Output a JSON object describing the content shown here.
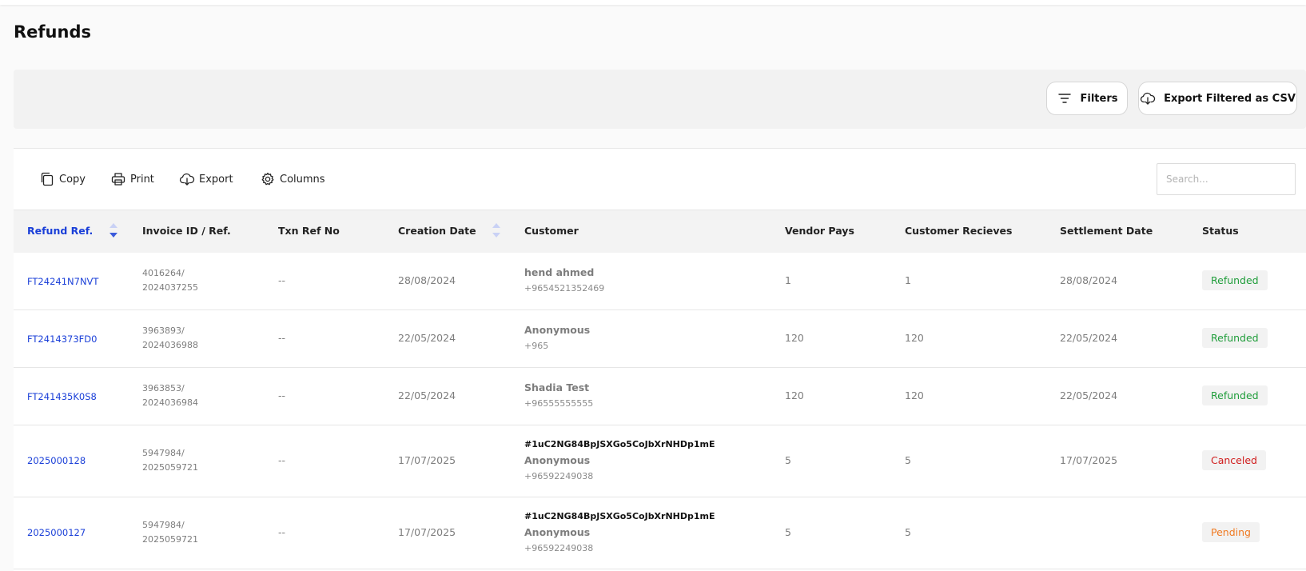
{
  "page": {
    "title": "Refunds"
  },
  "filter_bar": {
    "filters_label": "Filters",
    "export_csv_label": "Export Filtered as CSV"
  },
  "toolbar": {
    "copy_label": "Copy",
    "print_label": "Print",
    "export_label": "Export",
    "columns_label": "Columns",
    "search_placeholder": "Search..."
  },
  "table": {
    "columns": [
      "Refund Ref.",
      "Invoice ID / Ref.",
      "Txn Ref No",
      "Creation Date",
      "Customer",
      "Vendor Pays",
      "Customer Recieves",
      "Settlement Date",
      "Status"
    ],
    "rows": [
      {
        "refund_ref": "FT24241N7NVT",
        "invoice_id": "4016264/",
        "invoice_ref": "2024037255",
        "txn_ref": "--",
        "creation_date": "28/08/2024",
        "customer_token": "",
        "customer_name": "hend ahmed",
        "customer_phone": "+9654521352469",
        "vendor_pays": "1",
        "customer_receives": "1",
        "settlement_date": "28/08/2024",
        "status": "Refunded"
      },
      {
        "refund_ref": "FT2414373FD0",
        "invoice_id": "3963893/",
        "invoice_ref": "2024036988",
        "txn_ref": "--",
        "creation_date": "22/05/2024",
        "customer_token": "",
        "customer_name": "Anonymous",
        "customer_phone": "+965",
        "vendor_pays": "120",
        "customer_receives": "120",
        "settlement_date": "22/05/2024",
        "status": "Refunded"
      },
      {
        "refund_ref": "FT241435K0S8",
        "invoice_id": "3963853/",
        "invoice_ref": "2024036984",
        "txn_ref": "--",
        "creation_date": "22/05/2024",
        "customer_token": "",
        "customer_name": "Shadia Test",
        "customer_phone": "+96555555555",
        "vendor_pays": "120",
        "customer_receives": "120",
        "settlement_date": "22/05/2024",
        "status": "Refunded"
      },
      {
        "refund_ref": "2025000128",
        "invoice_id": "5947984/",
        "invoice_ref": "2025059721",
        "txn_ref": "--",
        "creation_date": "17/07/2025",
        "customer_token": "#1uC2NG84BpJSXGo5CoJbXrNHDp1mE",
        "customer_name": "Anonymous",
        "customer_phone": "+96592249038",
        "vendor_pays": "5",
        "customer_receives": "5",
        "settlement_date": "17/07/2025",
        "status": "Canceled"
      },
      {
        "refund_ref": "2025000127",
        "invoice_id": "5947984/",
        "invoice_ref": "2025059721",
        "txn_ref": "--",
        "creation_date": "17/07/2025",
        "customer_token": "#1uC2NG84BpJSXGo5CoJbXrNHDp1mE",
        "customer_name": "Anonymous",
        "customer_phone": "+96592249038",
        "vendor_pays": "5",
        "customer_receives": "5",
        "settlement_date": "",
        "status": "Pending"
      }
    ]
  },
  "colors": {
    "link": "#1a3fd8",
    "refunded": "#1f9d3a",
    "canceled": "#d01b1b",
    "pending": "#f07a22",
    "sort_active": "#3b5bdb",
    "sort_inactive": "#c9d1f5"
  },
  "icons": {
    "filters": "filter-lines-icon",
    "export_csv": "cloud-download-icon",
    "copy": "copy-icon",
    "print": "printer-icon",
    "export": "cloud-download-icon",
    "columns": "gear-icon",
    "sort": "sort-arrows-icon"
  }
}
